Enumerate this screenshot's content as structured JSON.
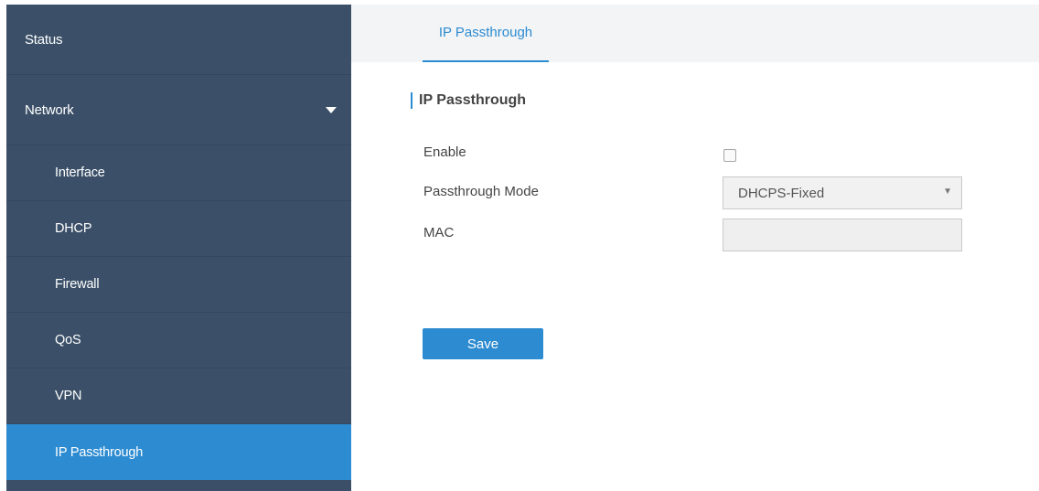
{
  "sidebar": {
    "items": [
      {
        "label": "Status"
      },
      {
        "label": "Network"
      }
    ],
    "network_sub": [
      {
        "label": "Interface"
      },
      {
        "label": "DHCP"
      },
      {
        "label": "Firewall"
      },
      {
        "label": "QoS"
      },
      {
        "label": "VPN"
      },
      {
        "label": "IP Passthrough"
      }
    ],
    "active_item": "IP Passthrough"
  },
  "tabs": [
    {
      "label": "IP Passthrough"
    }
  ],
  "section": {
    "title": "IP Passthrough"
  },
  "form": {
    "enable_label": "Enable",
    "enable_checked": false,
    "mode_label": "Passthrough Mode",
    "mode_value": "DHCPS-Fixed",
    "mac_label": "MAC",
    "mac_value": ""
  },
  "actions": {
    "save_label": "Save"
  },
  "colors": {
    "sidebar_bg": "#3b5068",
    "accent": "#2c8bd1",
    "tabbar_bg": "#f2f4f6"
  }
}
